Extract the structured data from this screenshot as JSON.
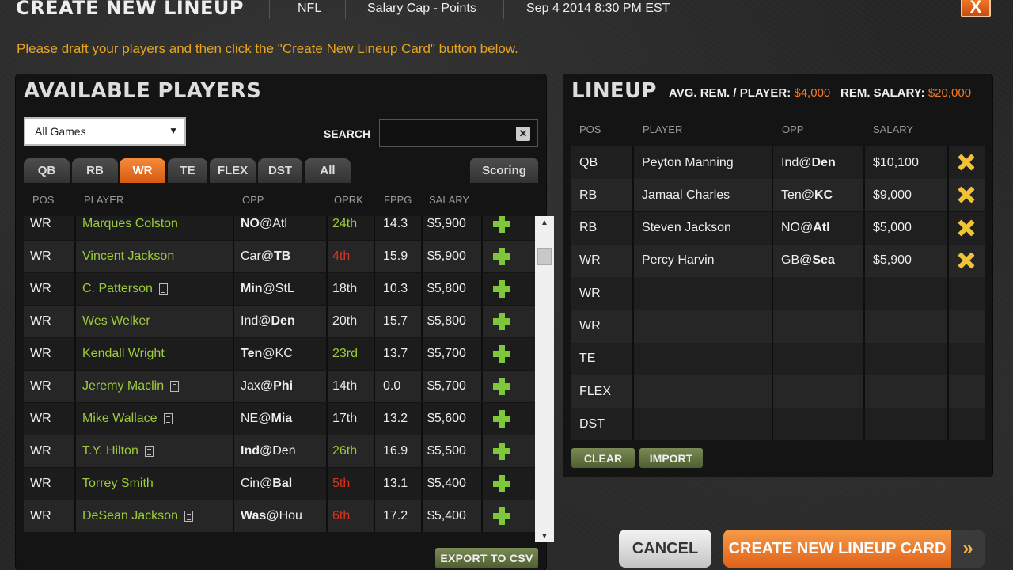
{
  "header": {
    "title": "CREATE NEW LINEUP",
    "sport": "NFL",
    "contest_type": "Salary Cap - Points",
    "datetime": "Sep 4 2014 8:30 PM EST",
    "close_label": "X"
  },
  "instructions": "Please draft your players and then click the \"Create New Lineup Card\" button below.",
  "available": {
    "title": "AVAILABLE PLAYERS",
    "games_select": "All Games",
    "search_label": "SEARCH",
    "search_value": "",
    "tabs": [
      {
        "label": "QB",
        "active": false
      },
      {
        "label": "RB",
        "active": false
      },
      {
        "label": "WR",
        "active": true
      },
      {
        "label": "TE",
        "active": false
      },
      {
        "label": "FLEX",
        "active": false
      },
      {
        "label": "DST",
        "active": false
      },
      {
        "label": "All",
        "active": false
      }
    ],
    "scoring_label": "Scoring",
    "columns": [
      "POS",
      "PLAYER",
      "OPP",
      "OPRK",
      "FPPG",
      "SALARY"
    ],
    "players": [
      {
        "pos": "WR",
        "name": "Marques Colston",
        "note": false,
        "opp_a": "NO",
        "opp_b": "Atl",
        "bold": "a",
        "oprk": "24th",
        "oprk_color": "green",
        "fppg": "14.3",
        "salary": "$5,900"
      },
      {
        "pos": "WR",
        "name": "Vincent Jackson",
        "note": false,
        "opp_a": "Car",
        "opp_b": "TB",
        "bold": "b",
        "oprk": "4th",
        "oprk_color": "red",
        "fppg": "15.9",
        "salary": "$5,900"
      },
      {
        "pos": "WR",
        "name": "C. Patterson",
        "note": true,
        "opp_a": "Min",
        "opp_b": "StL",
        "bold": "a",
        "oprk": "18th",
        "oprk_color": "white",
        "fppg": "10.3",
        "salary": "$5,800"
      },
      {
        "pos": "WR",
        "name": "Wes Welker",
        "note": false,
        "opp_a": "Ind",
        "opp_b": "Den",
        "bold": "b",
        "oprk": "20th",
        "oprk_color": "white",
        "fppg": "15.7",
        "salary": "$5,800"
      },
      {
        "pos": "WR",
        "name": "Kendall Wright",
        "note": false,
        "opp_a": "Ten",
        "opp_b": "KC",
        "bold": "a",
        "oprk": "23rd",
        "oprk_color": "green",
        "fppg": "13.7",
        "salary": "$5,700"
      },
      {
        "pos": "WR",
        "name": "Jeremy Maclin",
        "note": true,
        "opp_a": "Jax",
        "opp_b": "Phi",
        "bold": "b",
        "oprk": "14th",
        "oprk_color": "white",
        "fppg": "0.0",
        "salary": "$5,700"
      },
      {
        "pos": "WR",
        "name": "Mike Wallace",
        "note": true,
        "opp_a": "NE",
        "opp_b": "Mia",
        "bold": "b",
        "oprk": "17th",
        "oprk_color": "white",
        "fppg": "13.2",
        "salary": "$5,600"
      },
      {
        "pos": "WR",
        "name": "T.Y. Hilton",
        "note": true,
        "opp_a": "Ind",
        "opp_b": "Den",
        "bold": "a",
        "oprk": "26th",
        "oprk_color": "green",
        "fppg": "16.9",
        "salary": "$5,500"
      },
      {
        "pos": "WR",
        "name": "Torrey Smith",
        "note": false,
        "opp_a": "Cin",
        "opp_b": "Bal",
        "bold": "b",
        "oprk": "5th",
        "oprk_color": "red",
        "fppg": "13.1",
        "salary": "$5,400"
      },
      {
        "pos": "WR",
        "name": "DeSean Jackson",
        "note": true,
        "opp_a": "Was",
        "opp_b": "Hou",
        "bold": "a",
        "oprk": "6th",
        "oprk_color": "red",
        "fppg": "17.2",
        "salary": "$5,400"
      }
    ],
    "export_label": "EXPORT TO CSV"
  },
  "lineup": {
    "title": "LINEUP",
    "avg_label": "AVG. REM. / PLAYER:",
    "avg_value": "$4,000",
    "rem_label": "REM. SALARY:",
    "rem_value": "$20,000",
    "columns": [
      "POS",
      "PLAYER",
      "OPP",
      "SALARY"
    ],
    "slots": [
      {
        "pos": "QB",
        "name": "Peyton Manning",
        "opp_a": "Ind",
        "opp_b": "Den",
        "bold": "b",
        "salary": "$10,100"
      },
      {
        "pos": "RB",
        "name": "Jamaal Charles",
        "opp_a": "Ten",
        "opp_b": "KC",
        "bold": "b",
        "salary": "$9,000"
      },
      {
        "pos": "RB",
        "name": "Steven Jackson",
        "opp_a": "NO",
        "opp_b": "Atl",
        "bold": "b",
        "salary": "$5,000"
      },
      {
        "pos": "WR",
        "name": "Percy Harvin",
        "opp_a": "GB",
        "opp_b": "Sea",
        "bold": "b",
        "salary": "$5,900"
      },
      {
        "pos": "WR",
        "name": "",
        "opp_a": "",
        "opp_b": "",
        "bold": "",
        "salary": ""
      },
      {
        "pos": "WR",
        "name": "",
        "opp_a": "",
        "opp_b": "",
        "bold": "",
        "salary": ""
      },
      {
        "pos": "TE",
        "name": "",
        "opp_a": "",
        "opp_b": "",
        "bold": "",
        "salary": ""
      },
      {
        "pos": "FLEX",
        "name": "",
        "opp_a": "",
        "opp_b": "",
        "bold": "",
        "salary": ""
      },
      {
        "pos": "DST",
        "name": "",
        "opp_a": "",
        "opp_b": "",
        "bold": "",
        "salary": ""
      }
    ],
    "clear_label": "CLEAR",
    "import_label": "IMPORT"
  },
  "footer": {
    "cancel_label": "CANCEL",
    "create_label": "CREATE NEW LINEUP CARD",
    "create_arrow": "»"
  },
  "colors": {
    "accent": "#f07a2a",
    "player_green": "#9ccc3a",
    "rank_red": "#d8341f",
    "instruction_yellow": "#e8a521"
  }
}
